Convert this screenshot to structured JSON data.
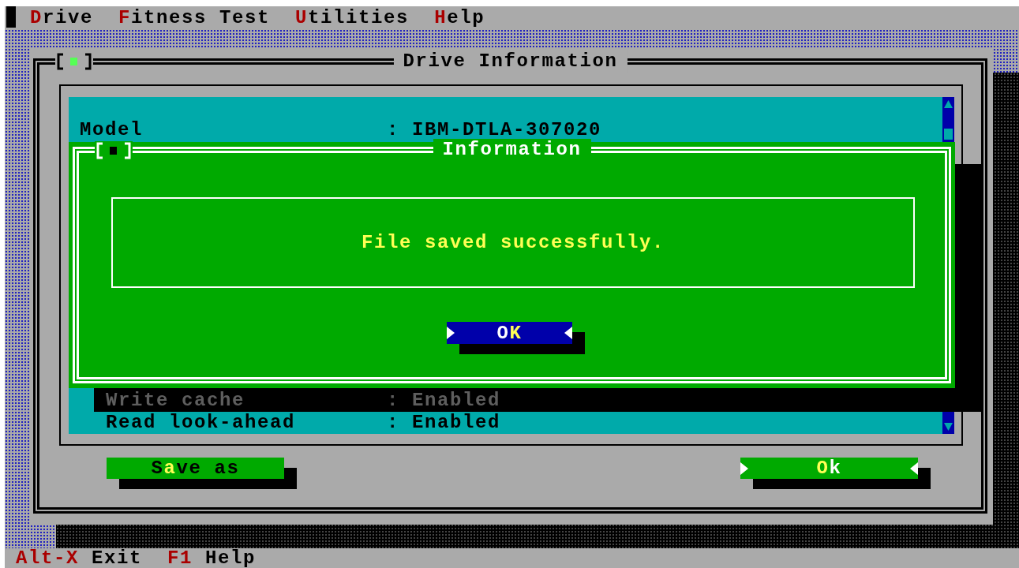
{
  "menu_bar": [
    {
      "parts": [
        {
          "text": "D",
          "hotkey": true
        },
        {
          "text": "rive",
          "hotkey": false
        }
      ]
    },
    {
      "parts": [
        {
          "text": "F",
          "hotkey": true
        },
        {
          "text": "itness Test",
          "hotkey": false
        }
      ]
    },
    {
      "parts": [
        {
          "text": "U",
          "hotkey": true
        },
        {
          "text": "tilities",
          "hotkey": false
        }
      ]
    },
    {
      "parts": [
        {
          "text": "H",
          "hotkey": true
        },
        {
          "text": "elp",
          "hotkey": false
        }
      ]
    }
  ],
  "window": {
    "title": "Drive Information",
    "rows": [
      {
        "kind": "heading",
        "label": "Model",
        "value": ": IBM-DTLA-307020",
        "shadowed": false
      },
      {
        "kind": "item",
        "label": "Write cache",
        "value": ": Enabled",
        "shadowed": true
      },
      {
        "kind": "item",
        "label": "Read look-ahead",
        "value": ": Enabled",
        "shadowed": false
      }
    ],
    "buttons": [
      {
        "parts": [
          {
            "text": "S",
            "hotkey": false
          },
          {
            "text": "a",
            "hotkey": true
          },
          {
            "text": "ve as",
            "hotkey": false
          }
        ],
        "default": false,
        "focused": false
      },
      {
        "parts": [
          {
            "text": "O",
            "hotkey": true
          },
          {
            "text": "k",
            "hotkey": false
          }
        ],
        "default": true,
        "focused": false
      }
    ]
  },
  "dialog": {
    "title": "Information",
    "message": "File saved successfully.",
    "button": {
      "parts": [
        {
          "text": "O",
          "hotkey": false
        },
        {
          "text": "K",
          "hotkey": true
        }
      ],
      "default": true,
      "focused": true
    }
  },
  "status_bar": [
    {
      "key": "Alt-X",
      "label": "Exit"
    },
    {
      "key": "F1",
      "label": "Help"
    }
  ]
}
